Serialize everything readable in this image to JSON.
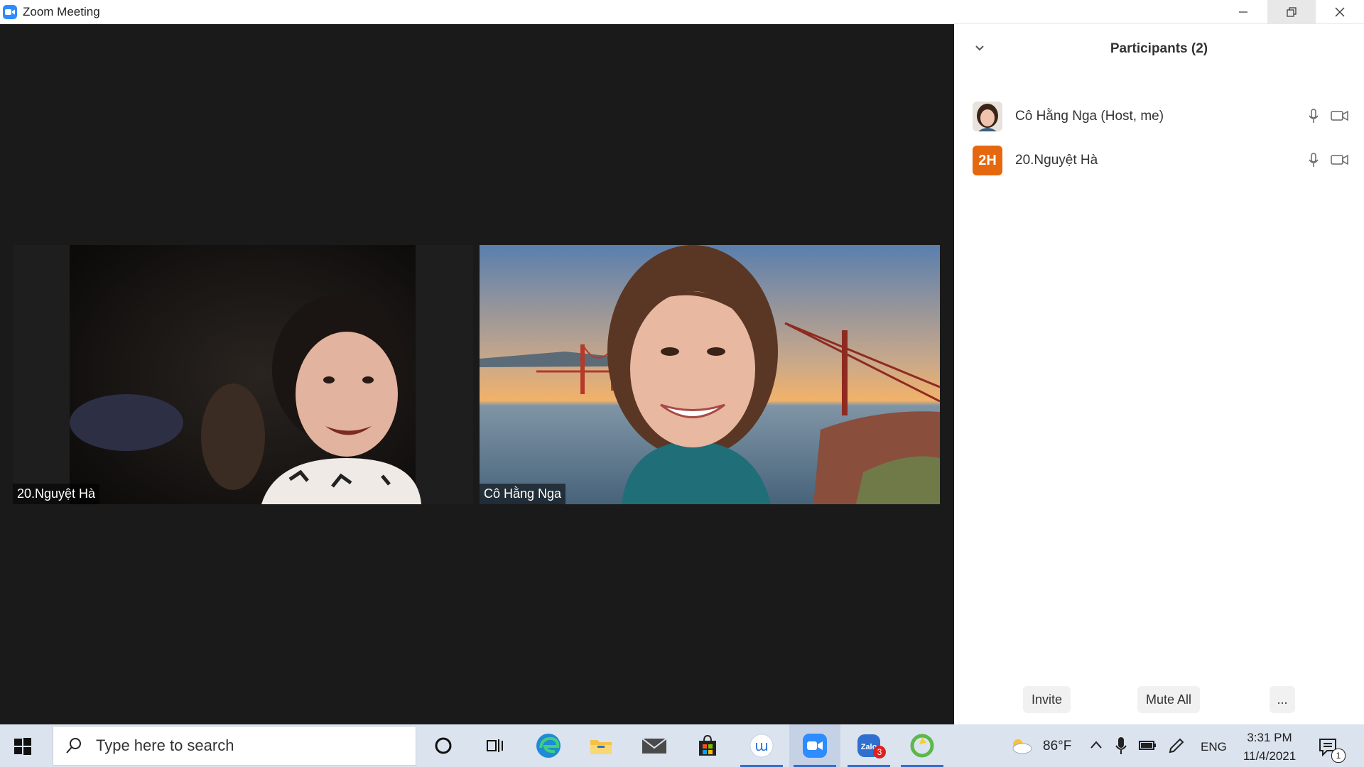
{
  "window": {
    "title": "Zoom Meeting"
  },
  "videos": [
    {
      "name": "20.Nguyệt Hà"
    },
    {
      "name": "Cô Hằng Nga"
    }
  ],
  "panel": {
    "title": "Participants (2)",
    "participants": [
      {
        "name": "Cô Hằng Nga (Host, me)",
        "avatar": "photo"
      },
      {
        "name": "20.Nguyệt Hà",
        "initials": "2H"
      }
    ],
    "buttons": {
      "invite": "Invite",
      "mute_all": "Mute All",
      "more": "..."
    }
  },
  "taskbar": {
    "search_placeholder": "Type here to search",
    "weather": "86°F",
    "language": "ENG",
    "time": "3:31 PM",
    "date": "11/4/2021",
    "zalo_badge": "3",
    "notification_badge": "1",
    "colors": {
      "accent": "#2f6fd0",
      "zoom_blue": "#2d8cff",
      "avatar_orange": "#e5680f"
    }
  }
}
